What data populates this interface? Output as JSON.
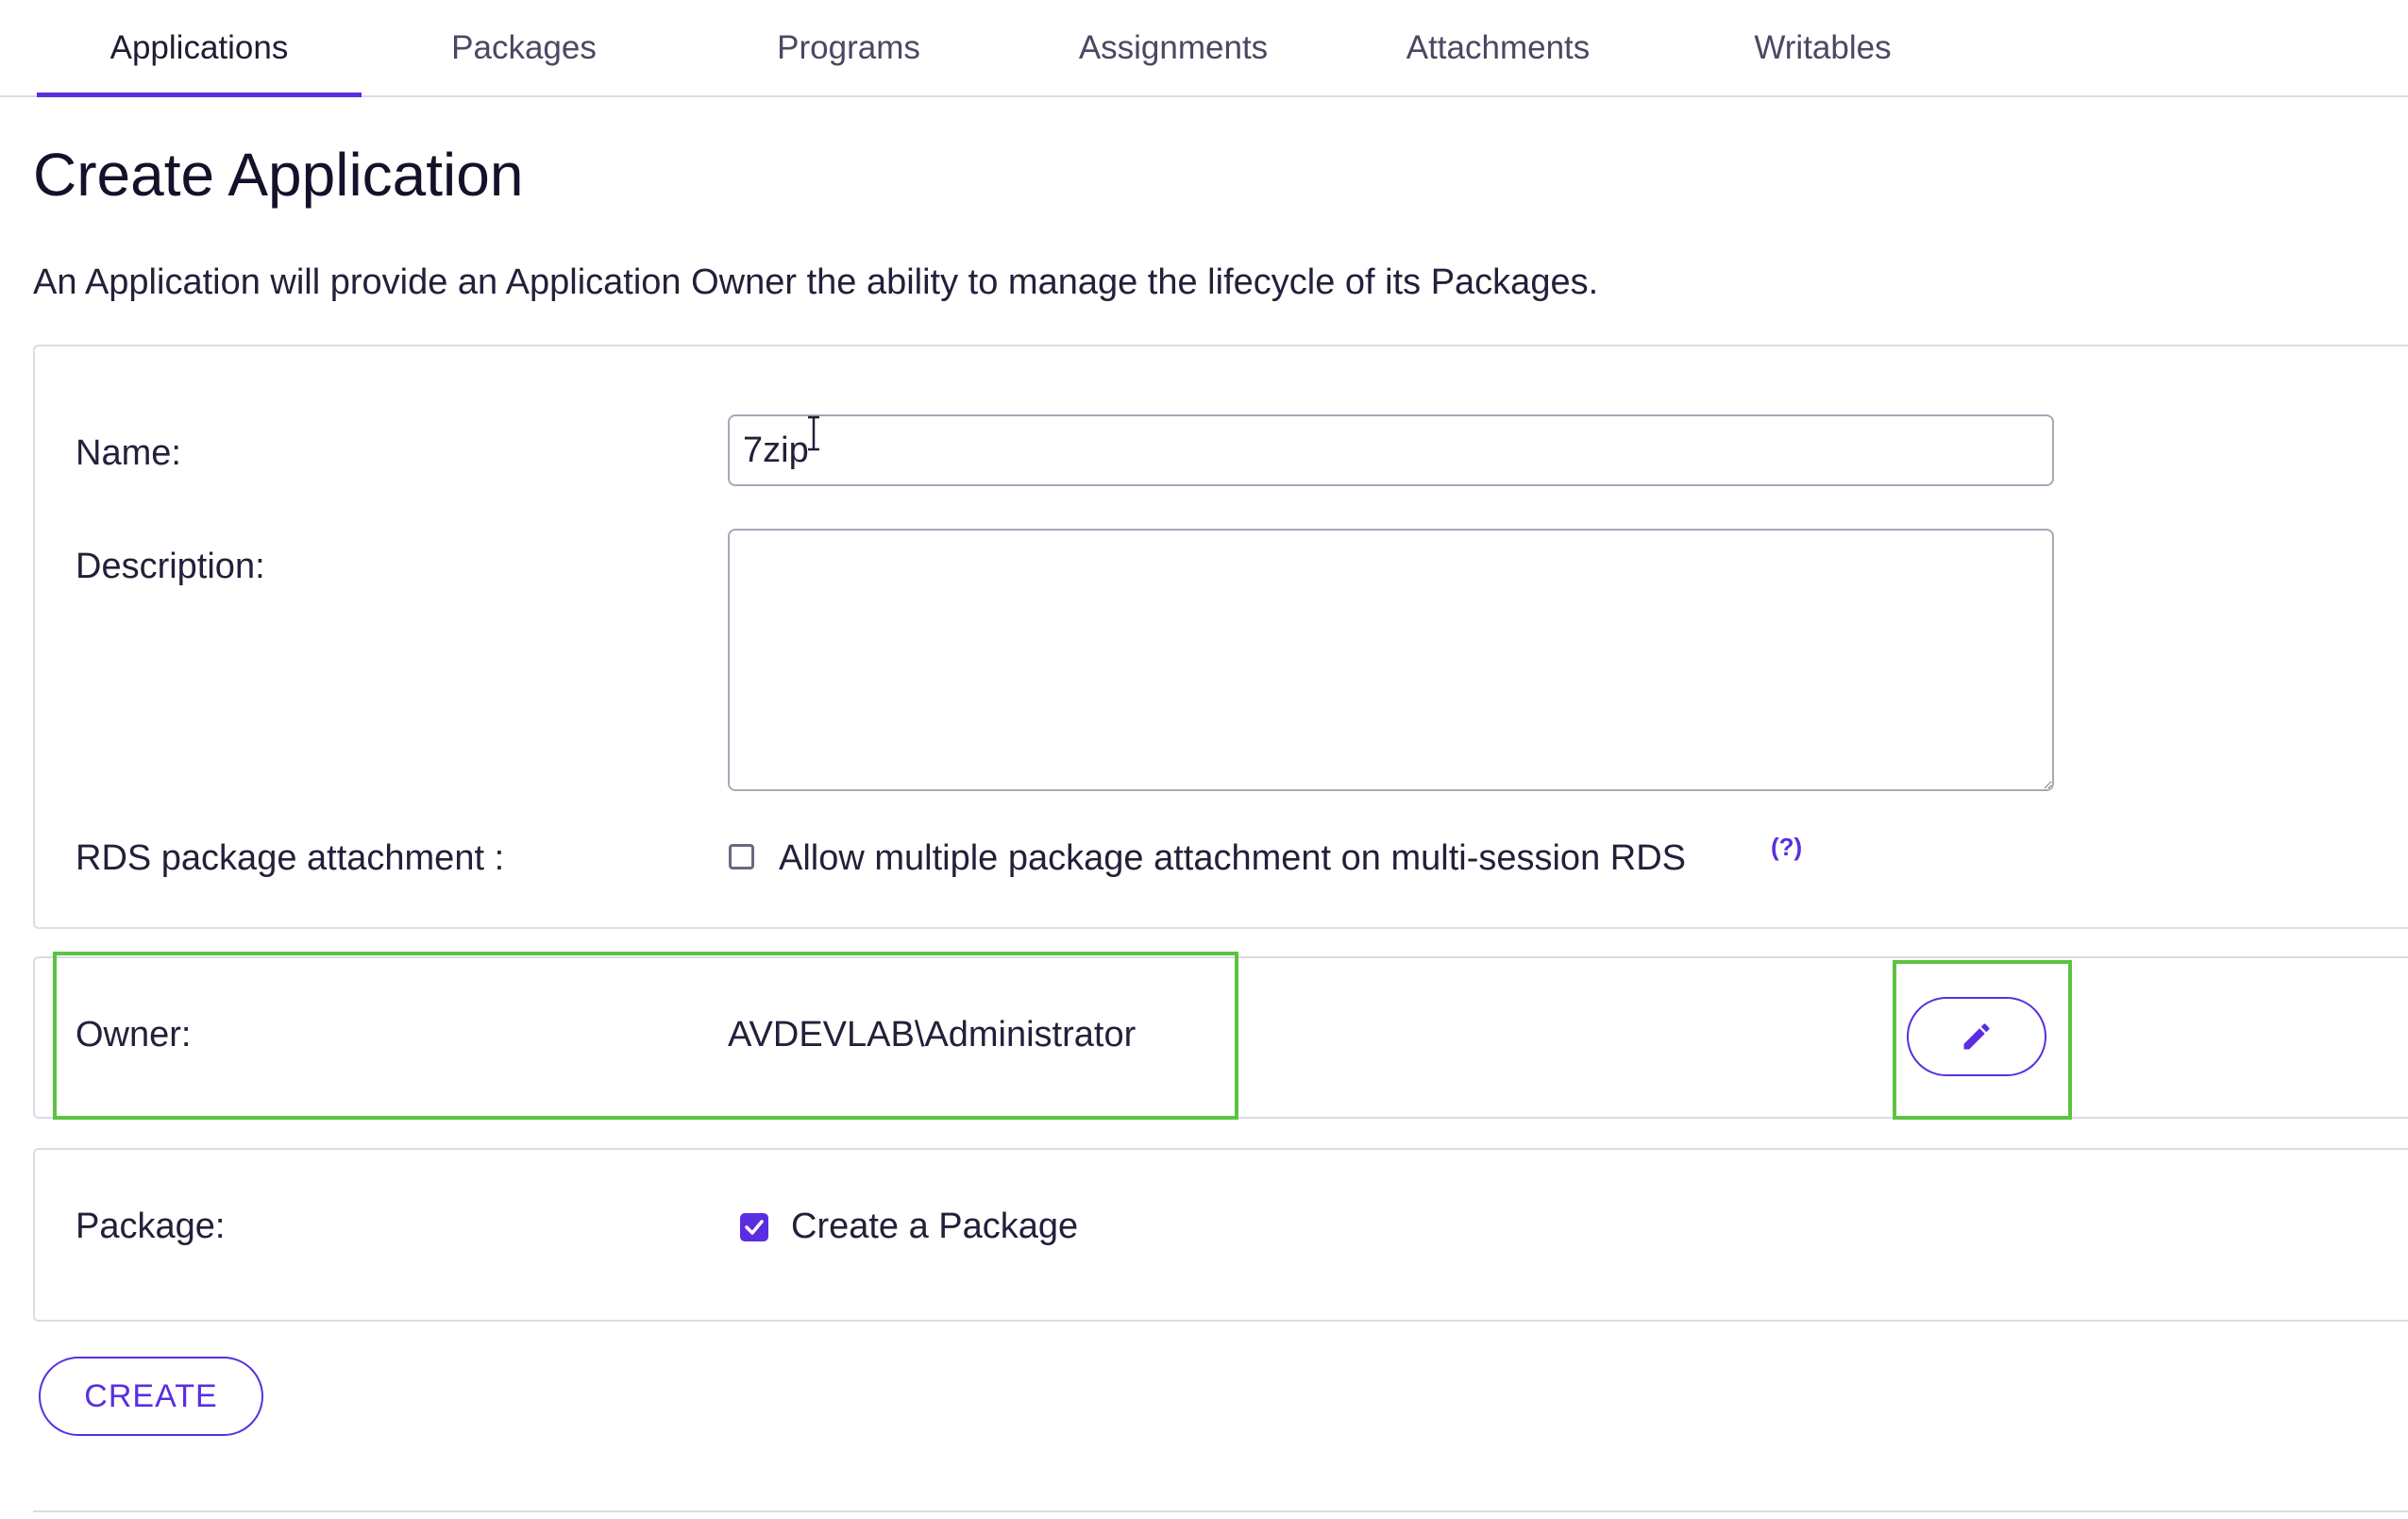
{
  "tabs": [
    {
      "label": "Applications",
      "active": true
    },
    {
      "label": "Packages"
    },
    {
      "label": "Programs"
    },
    {
      "label": "Assignments"
    },
    {
      "label": "Attachments"
    },
    {
      "label": "Writables"
    }
  ],
  "page": {
    "title": "Create Application",
    "description": "An Application will provide an Application Owner the ability to manage the lifecycle of its Packages."
  },
  "form": {
    "name_label": "Name:",
    "name_value": "7zip",
    "description_label": "Description:",
    "description_value": "",
    "rds_label": "RDS package attachment :",
    "rds_checkbox_label": "Allow multiple package attachment on multi-session RDS",
    "rds_checked": false,
    "rds_help": "(?)",
    "owner_label": "Owner:",
    "owner_value": "AVDEVLAB\\Administrator",
    "edit_owner_icon": "pencil-icon",
    "package_label": "Package:",
    "package_checkbox_label": "Create a Package",
    "package_checked": true
  },
  "actions": {
    "create_label": "CREATE"
  },
  "colors": {
    "accent": "#5a2ee0",
    "highlight": "#5dc243",
    "border": "#dcdbe6"
  }
}
